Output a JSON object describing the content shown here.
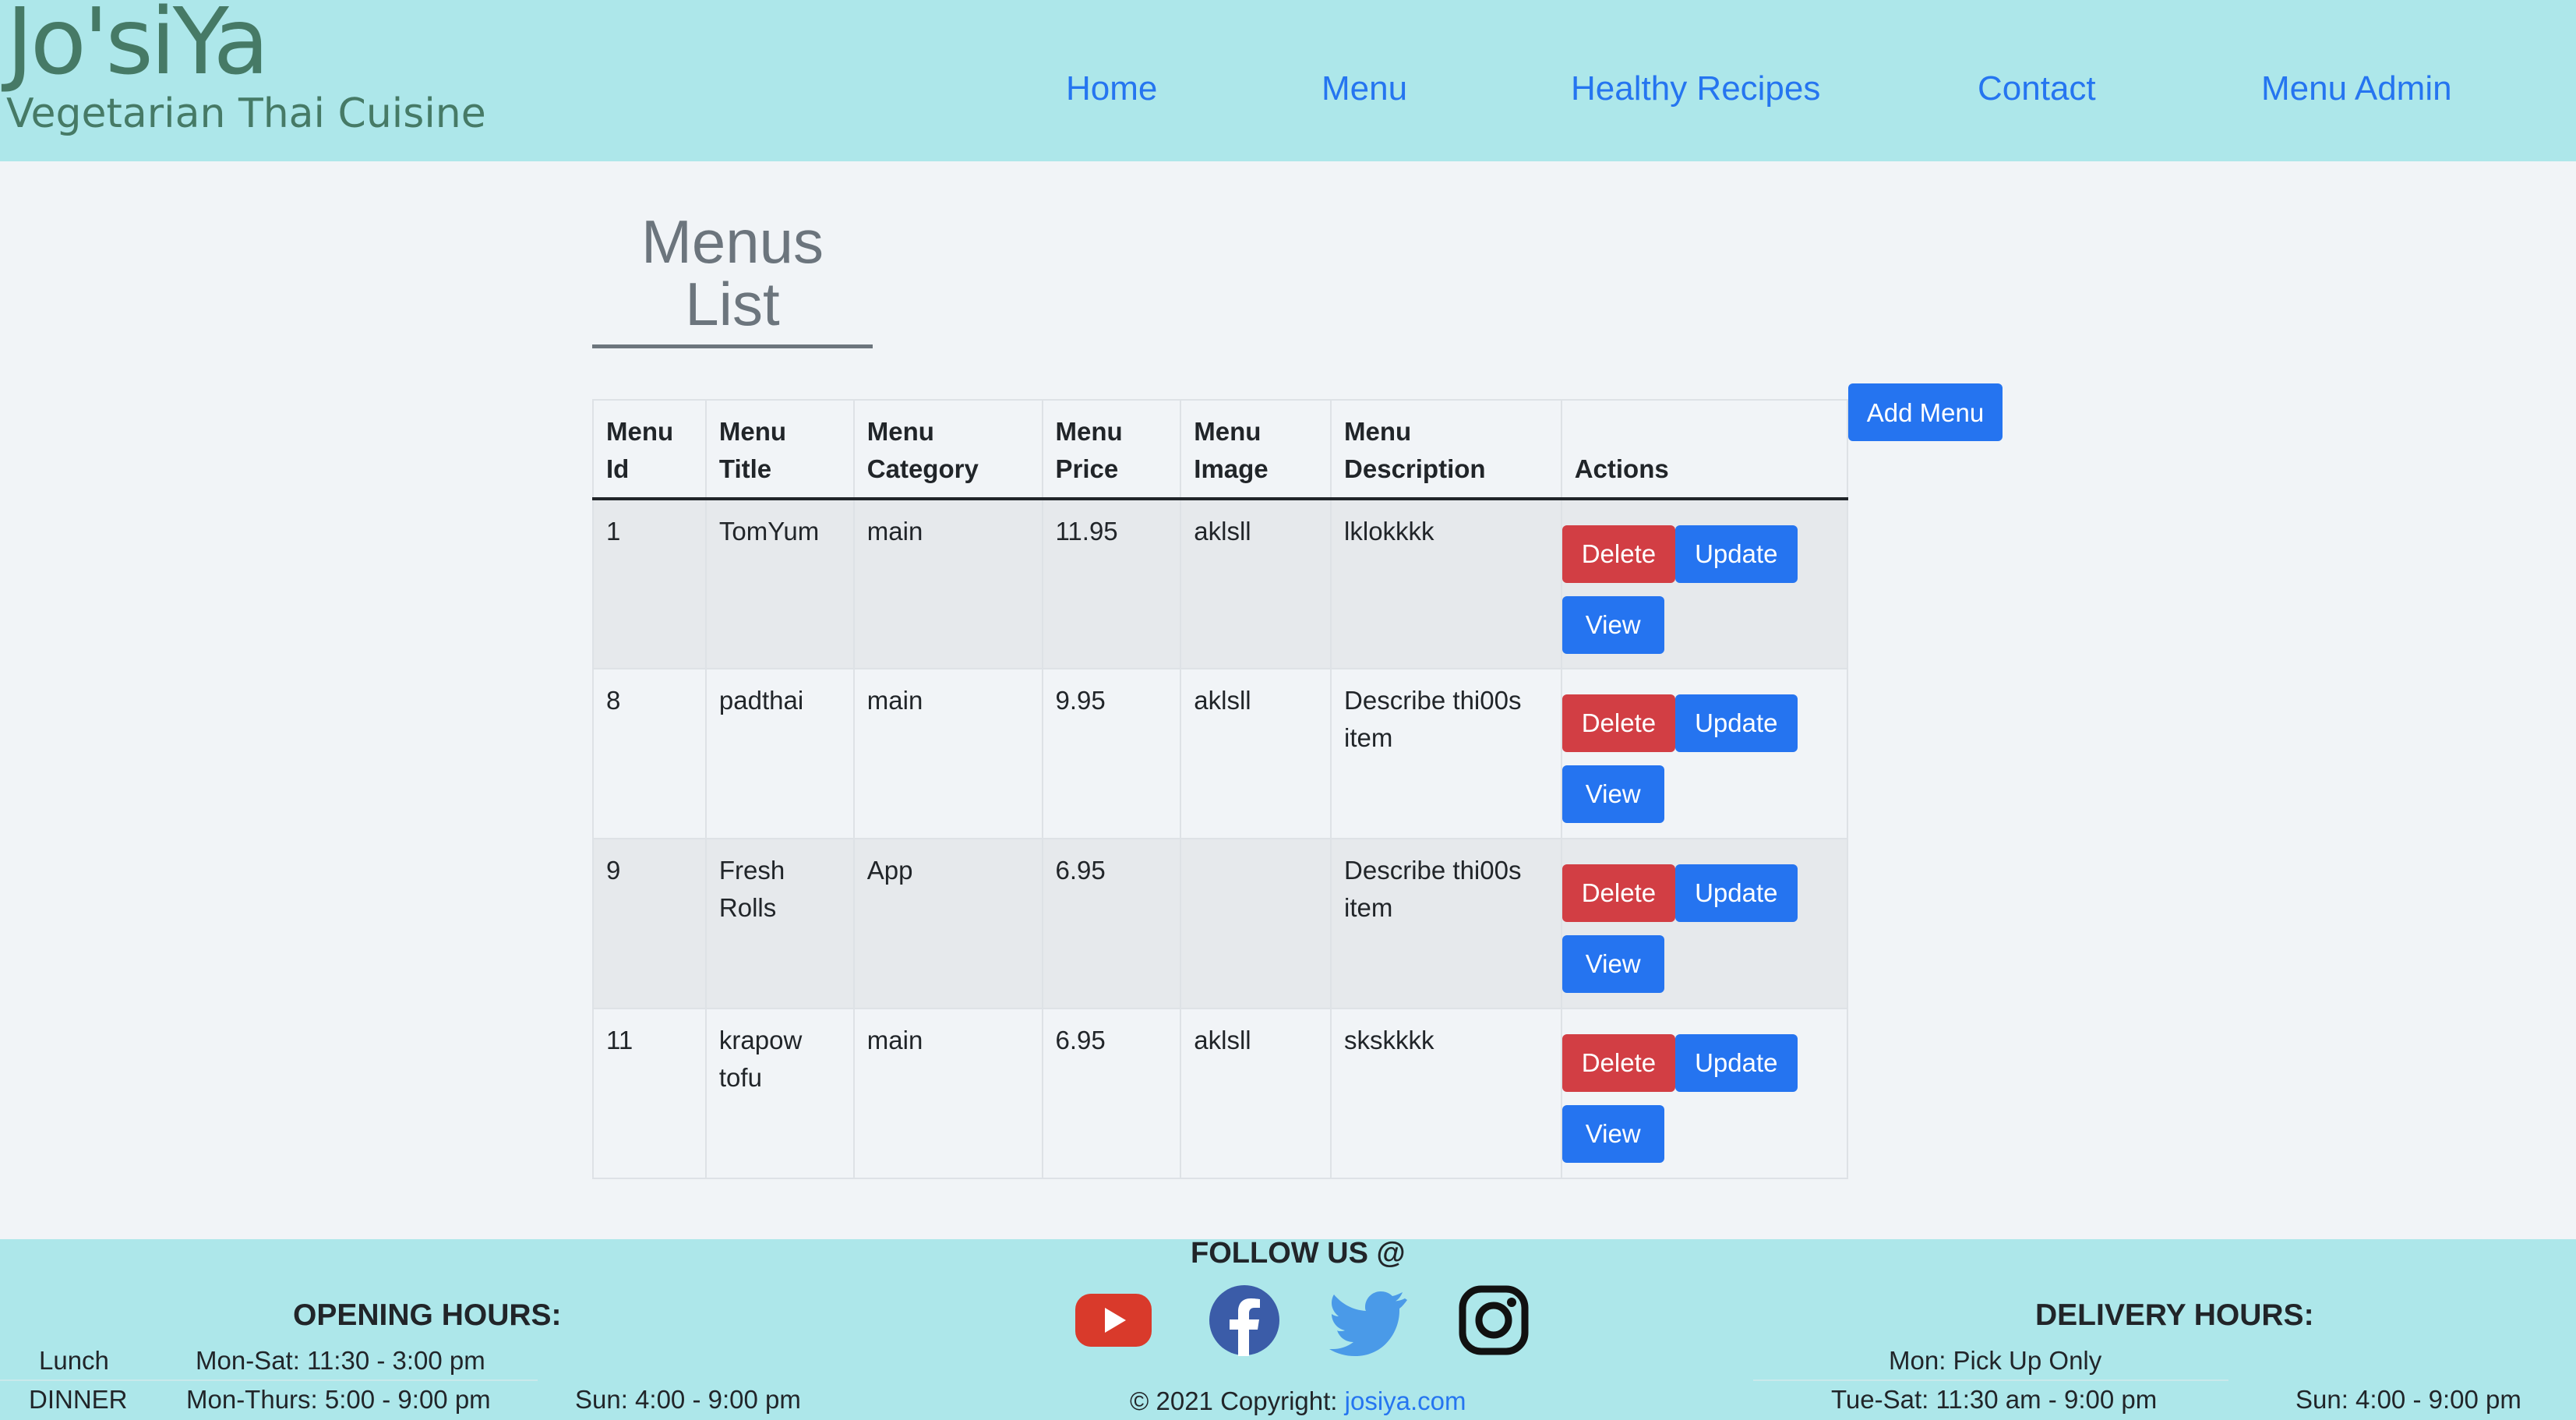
{
  "brand": {
    "name": "Jo'siYa",
    "tagline": "Vegetarian Thai Cuisine"
  },
  "nav": {
    "items": [
      "Home",
      "Menu",
      "Healthy Recipes",
      "Contact",
      "Menu Admin"
    ]
  },
  "page": {
    "title_line1": "Menus",
    "title_line2": "List",
    "add_label": "Add Menu"
  },
  "table": {
    "headers": [
      [
        "Menu",
        "Id"
      ],
      [
        "Menu",
        "Title"
      ],
      [
        "Menu",
        "Category"
      ],
      [
        "Menu",
        "Price"
      ],
      [
        "Menu",
        "Image"
      ],
      [
        "Menu",
        "Description"
      ],
      [
        "",
        "Actions"
      ]
    ],
    "rows": [
      {
        "id": "1",
        "title": "TomYum",
        "category": "main",
        "price": "11.95",
        "image": "aklsll",
        "description": "lklokkkk"
      },
      {
        "id": "8",
        "title": "padthai",
        "category": "main",
        "price": "9.95",
        "image": "aklsll",
        "description": "Describe thi00s item"
      },
      {
        "id": "9",
        "title": "Fresh Rolls",
        "category": "App",
        "price": "6.95",
        "image": "",
        "description": "Describe thi00s item"
      },
      {
        "id": "11",
        "title": "krapow tofu",
        "category": "main",
        "price": "6.95",
        "image": "aklsll",
        "description": "skskkkk"
      }
    ],
    "action_labels": {
      "delete": "Delete",
      "update": "Update",
      "view": "View"
    },
    "colors": {
      "delete": "#d23e44",
      "primary": "#2574f0"
    }
  },
  "footer": {
    "opening_title": "OPENING HOURS:",
    "lunch_label": "Lunch",
    "lunch_hours": "Mon-Sat: 11:30 - 3:00 pm",
    "dinner_label": "DINNER",
    "dinner_hours": "Mon-Thurs: 5:00 - 9:00 pm",
    "dinner_sun": "Sun: 4:00 - 9:00 pm",
    "follow_title": "FOLLOW US @",
    "social": [
      "youtube-icon",
      "facebook-icon",
      "twitter-icon",
      "instagram-icon"
    ],
    "copyright": "© 2021 Copyright:",
    "copyright_link": "josiya.com",
    "delivery_title": "DELIVERY HOURS:",
    "delivery_mon": "Mon: Pick Up Only",
    "delivery_tue_sat": "Tue-Sat: 11:30 am - 9:00 pm",
    "delivery_sun": "Sun: 4:00 - 9:00 pm"
  }
}
